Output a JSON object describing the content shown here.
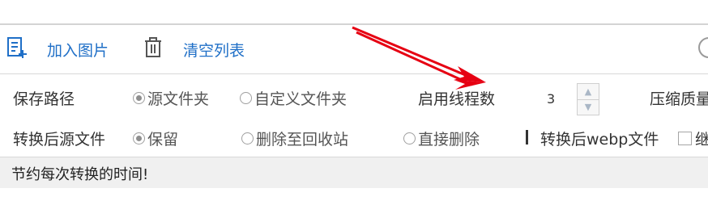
{
  "toolbar": {
    "add_images_label": "加入图片",
    "clear_list_label": "清空列表"
  },
  "settings": {
    "save_path_label": "保存路径",
    "save_options": [
      "源文件夹",
      "自定义文件夹"
    ],
    "threads_label": "启用线程数",
    "threads_value": "3",
    "quality_label": "压缩质量",
    "source_after_label": "转换后源文件",
    "source_options": [
      "保留",
      "删除至回收站",
      "直接删除"
    ],
    "webp_file_label": "转换后webp文件",
    "webp_option_partial": "继"
  },
  "status": {
    "message": "节约每次转换的时间!"
  },
  "colors": {
    "accent": "#1f6fc7",
    "arrow": "#e60012",
    "status_bg": "#f0f0f0"
  }
}
